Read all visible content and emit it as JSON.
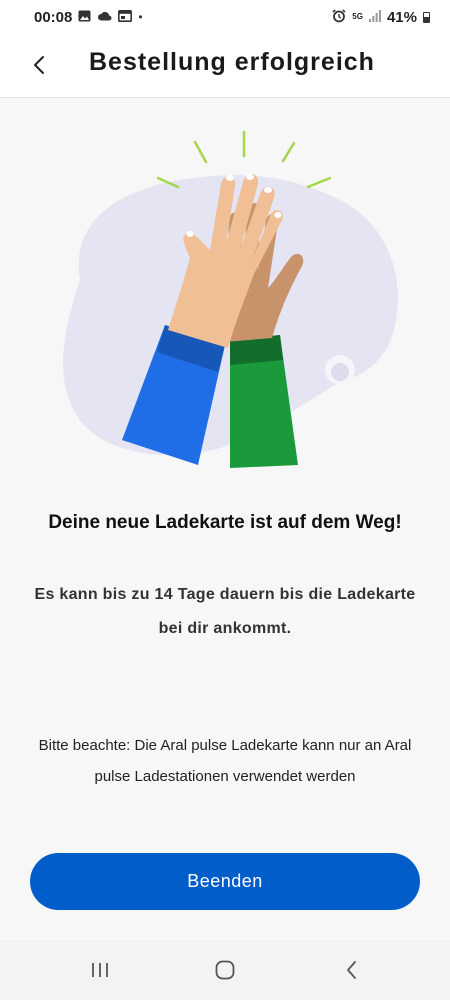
{
  "status_bar": {
    "time": "00:08",
    "notification_icons": [
      "image-icon",
      "cloud-icon",
      "cast-icon",
      "dot-icon"
    ],
    "alarm_icon": "alarm-icon",
    "network": "5G",
    "signal_icon": "signal-icon",
    "battery": "41%"
  },
  "header": {
    "back_icon": "chevron-left-icon",
    "title": "Bestellung erfolgreich"
  },
  "illustration": {
    "name": "high-five",
    "colors": {
      "blob": "#e4e4f2",
      "blue_sleeve": "#1f6ee8",
      "green_sleeve": "#1a9a3a",
      "light_hand": "#f0bf95",
      "dark_hand": "#c8926a",
      "sparks": "#a6d64a"
    }
  },
  "content": {
    "headline": "Deine neue Ladekarte ist auf dem Weg!",
    "subline": "Es kann bis zu 14 Tage dauern bis die Ladekarte bei dir ankommt.",
    "note": "Bitte beachte: Die Aral pulse Ladekarte kann nur an Aral pulse Ladestationen verwendet werden"
  },
  "actions": {
    "finish_label": "Beenden",
    "accent_color": "#005dca"
  },
  "nav_bar": {
    "recents_icon": "recents-icon",
    "home_icon": "home-icon",
    "back_icon": "back-icon"
  }
}
